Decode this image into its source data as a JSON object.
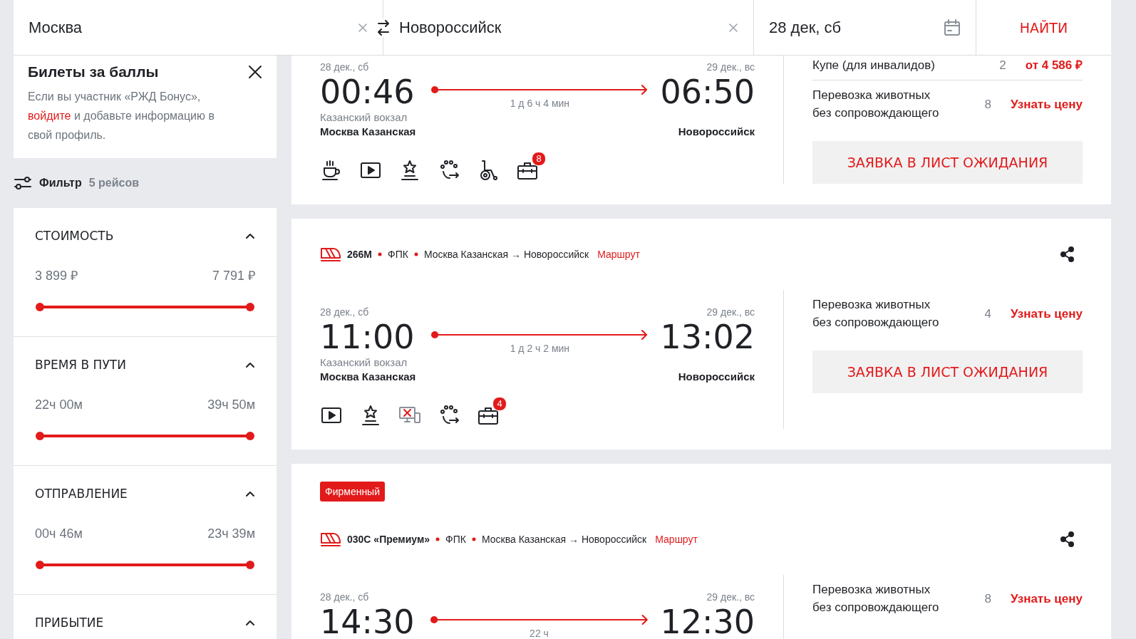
{
  "search": {
    "from": {
      "value": "Москва"
    },
    "to": {
      "value": "Новороссийск"
    },
    "date": {
      "value": "28 дек, сб"
    },
    "find_button": "НАЙТИ"
  },
  "bonus_panel": {
    "title": "Билеты за баллы",
    "text_before": "Если вы участник «РЖД Бонус»,",
    "link": "войдите",
    "text_after": "и добавьте информацию в свой профиль."
  },
  "filter": {
    "label": "Фильтр",
    "count": "5 рейсов"
  },
  "filter_sections": [
    {
      "title": "СТОИМОСТЬ",
      "expanded": true,
      "min": "3 899 ₽",
      "max": "7 791 ₽",
      "thumbs": [
        {
          "level": 0
        },
        {
          "level": 1
        }
      ]
    },
    {
      "title": "ВРЕМЯ В ПУТИ",
      "expanded": true,
      "min": "22ч 00м",
      "max": "39ч 50м",
      "thumbs": [
        {
          "level": 0
        },
        {
          "level": 1
        }
      ]
    },
    {
      "title": "ОТПРАВЛЕНИЕ",
      "expanded": true,
      "min": "00ч 46м",
      "max": "23ч 39м",
      "thumbs": [
        {
          "level": 0
        },
        {
          "level": 1
        }
      ]
    },
    {
      "title": "ПРИБЫТИЕ",
      "expanded": true
    }
  ],
  "trains": [
    {
      "depart": {
        "date": "28 дек., сб",
        "time": "00:46",
        "station": "Казанский вокзал",
        "city": "Москва Казанская"
      },
      "duration": "1 д 6 ч 4 мин",
      "arrive": {
        "date": "29 дек., вс",
        "time": "06:50",
        "city": "Новороссийск"
      },
      "amenities": [
        {
          "kind": "coffee"
        },
        {
          "kind": "video"
        },
        {
          "kind": "award"
        },
        {
          "kind": "pets"
        },
        {
          "kind": "wheelchair"
        },
        {
          "kind": "luggage",
          "badge": "8"
        }
      ],
      "offers": [
        {
          "name": "Купе (для инвалидов)",
          "seats": "2",
          "price": "от 4 586 ₽"
        },
        {
          "name": "Перевозка животных без сопровождающего",
          "seats": "8",
          "price": "Узнать цену"
        }
      ],
      "waitlist_button": "ЗАЯВКА В ЛИСТ ОЖИДАНИЯ"
    },
    {
      "number": "266М",
      "carrier": "ФПК",
      "route": "Москва Казанская → Новороссийск",
      "route_link": "Маршрут",
      "depart": {
        "date": "28 дек., сб",
        "time": "11:00",
        "station": "Казанский вокзал",
        "city": "Москва Казанская"
      },
      "duration": "1 д 2 ч 2 мин",
      "arrive": {
        "date": "29 дек., вс",
        "time": "13:02",
        "city": "Новороссийск"
      },
      "amenities": [
        {
          "kind": "video"
        },
        {
          "kind": "award"
        },
        {
          "kind": "no_screen"
        },
        {
          "kind": "pets"
        },
        {
          "kind": "luggage",
          "badge": "4"
        }
      ],
      "offers": [
        {
          "name": "Перевозка животных без сопровождающего",
          "seats": "4",
          "price": "Узнать цену"
        }
      ],
      "waitlist_button": "ЗАЯВКА В ЛИСТ ОЖИДАНИЯ"
    },
    {
      "badge": "Фирменный",
      "number": "030С «Премиум»",
      "carrier": "ФПК",
      "route": "Москва Казанская → Новороссийск",
      "route_link": "Маршрут",
      "depart": {
        "date": "28 дек., сб",
        "time": "14:30"
      },
      "duration": "22 ч",
      "arrive": {
        "date": "29 дек., вс",
        "time": "12:30"
      },
      "offers": [
        {
          "name": "Перевозка животных без сопровождающего",
          "seats": "8",
          "price": "Узнать цену"
        }
      ]
    }
  ]
}
